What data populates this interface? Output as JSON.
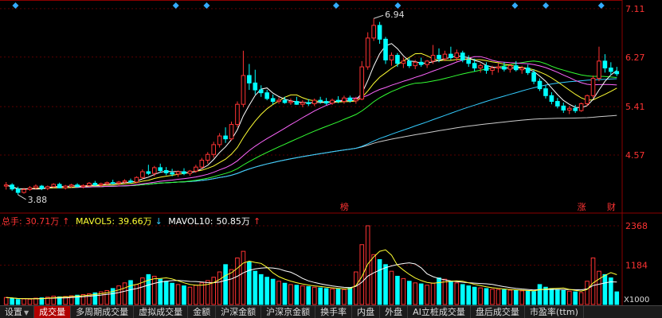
{
  "chart_data": [
    {
      "type": "candlestick",
      "title": "",
      "ylim": [
        3.7,
        7.15
      ],
      "yticks": [
        7.11,
        6.27,
        5.41,
        4.57
      ],
      "annotations": {
        "high_label": "6.94",
        "low_label": "3.88",
        "markers": [
          "榜",
          "涨",
          "财"
        ]
      },
      "colors": {
        "up": "#ff3333",
        "down": "#00ffff",
        "ma5": "#ffffff",
        "ma10": "#ffff33",
        "ma20": "#ff66ff",
        "ma30": "#33ff33",
        "ma60": "#33ccff",
        "ma120": "#cccccc"
      },
      "candles": [
        {
          "o": 4.03,
          "h": 4.1,
          "l": 3.97,
          "c": 4.05
        },
        {
          "o": 4.05,
          "h": 4.08,
          "l": 3.95,
          "c": 3.98
        },
        {
          "o": 3.98,
          "h": 4.02,
          "l": 3.88,
          "c": 3.92
        },
        {
          "o": 3.92,
          "h": 4.0,
          "l": 3.9,
          "c": 3.97
        },
        {
          "o": 3.97,
          "h": 4.03,
          "l": 3.95,
          "c": 4.0
        },
        {
          "o": 4.0,
          "h": 4.06,
          "l": 3.97,
          "c": 4.03
        },
        {
          "o": 4.03,
          "h": 4.05,
          "l": 3.96,
          "c": 3.99
        },
        {
          "o": 3.99,
          "h": 4.04,
          "l": 3.96,
          "c": 4.02
        },
        {
          "o": 4.02,
          "h": 4.08,
          "l": 4.0,
          "c": 4.06
        },
        {
          "o": 4.06,
          "h": 4.09,
          "l": 3.99,
          "c": 4.0
        },
        {
          "o": 4.0,
          "h": 4.05,
          "l": 3.97,
          "c": 4.03
        },
        {
          "o": 4.03,
          "h": 4.07,
          "l": 4.0,
          "c": 4.05
        },
        {
          "o": 4.05,
          "h": 4.08,
          "l": 4.01,
          "c": 4.02
        },
        {
          "o": 4.02,
          "h": 4.06,
          "l": 3.99,
          "c": 4.04
        },
        {
          "o": 4.04,
          "h": 4.1,
          "l": 4.02,
          "c": 4.08
        },
        {
          "o": 4.08,
          "h": 4.12,
          "l": 4.03,
          "c": 4.05
        },
        {
          "o": 4.05,
          "h": 4.09,
          "l": 4.01,
          "c": 4.07
        },
        {
          "o": 4.07,
          "h": 4.11,
          "l": 4.04,
          "c": 4.09
        },
        {
          "o": 4.09,
          "h": 4.14,
          "l": 4.06,
          "c": 4.08
        },
        {
          "o": 4.08,
          "h": 4.12,
          "l": 4.04,
          "c": 4.1
        },
        {
          "o": 4.1,
          "h": 4.15,
          "l": 4.07,
          "c": 4.12
        },
        {
          "o": 4.12,
          "h": 4.16,
          "l": 4.08,
          "c": 4.1
        },
        {
          "o": 4.1,
          "h": 4.2,
          "l": 4.08,
          "c": 4.18
        },
        {
          "o": 4.18,
          "h": 4.32,
          "l": 4.15,
          "c": 4.28
        },
        {
          "o": 4.28,
          "h": 4.4,
          "l": 4.22,
          "c": 4.25
        },
        {
          "o": 4.25,
          "h": 4.38,
          "l": 4.2,
          "c": 4.35
        },
        {
          "o": 4.35,
          "h": 4.42,
          "l": 4.26,
          "c": 4.3
        },
        {
          "o": 4.3,
          "h": 4.36,
          "l": 4.22,
          "c": 4.26
        },
        {
          "o": 4.26,
          "h": 4.33,
          "l": 4.2,
          "c": 4.24
        },
        {
          "o": 4.24,
          "h": 4.3,
          "l": 4.19,
          "c": 4.28
        },
        {
          "o": 4.28,
          "h": 4.34,
          "l": 4.22,
          "c": 4.25
        },
        {
          "o": 4.25,
          "h": 4.31,
          "l": 4.21,
          "c": 4.29
        },
        {
          "o": 4.29,
          "h": 4.4,
          "l": 4.26,
          "c": 4.36
        },
        {
          "o": 4.36,
          "h": 4.52,
          "l": 4.33,
          "c": 4.48
        },
        {
          "o": 4.48,
          "h": 4.62,
          "l": 4.42,
          "c": 4.58
        },
        {
          "o": 4.58,
          "h": 4.8,
          "l": 4.52,
          "c": 4.75
        },
        {
          "o": 4.75,
          "h": 4.95,
          "l": 4.7,
          "c": 4.9
        },
        {
          "o": 4.9,
          "h": 5.05,
          "l": 4.78,
          "c": 4.85
        },
        {
          "o": 4.85,
          "h": 5.15,
          "l": 4.82,
          "c": 5.1
        },
        {
          "o": 5.1,
          "h": 5.5,
          "l": 5.05,
          "c": 5.45
        },
        {
          "o": 5.45,
          "h": 6.38,
          "l": 5.4,
          "c": 5.95
        },
        {
          "o": 5.95,
          "h": 6.15,
          "l": 5.7,
          "c": 5.82
        },
        {
          "o": 5.82,
          "h": 6.05,
          "l": 5.62,
          "c": 5.7
        },
        {
          "o": 5.7,
          "h": 5.78,
          "l": 5.58,
          "c": 5.65
        },
        {
          "o": 5.65,
          "h": 5.7,
          "l": 5.52,
          "c": 5.55
        },
        {
          "o": 5.55,
          "h": 5.62,
          "l": 5.45,
          "c": 5.5
        },
        {
          "o": 5.5,
          "h": 5.57,
          "l": 5.46,
          "c": 5.52
        },
        {
          "o": 5.52,
          "h": 5.58,
          "l": 5.46,
          "c": 5.48
        },
        {
          "o": 5.48,
          "h": 5.55,
          "l": 5.44,
          "c": 5.5
        },
        {
          "o": 5.5,
          "h": 5.58,
          "l": 5.44,
          "c": 5.45
        },
        {
          "o": 5.45,
          "h": 5.52,
          "l": 5.4,
          "c": 5.48
        },
        {
          "o": 5.48,
          "h": 5.54,
          "l": 5.42,
          "c": 5.46
        },
        {
          "o": 5.46,
          "h": 5.55,
          "l": 5.42,
          "c": 5.52
        },
        {
          "o": 5.52,
          "h": 5.58,
          "l": 5.46,
          "c": 5.5
        },
        {
          "o": 5.5,
          "h": 5.56,
          "l": 5.44,
          "c": 5.47
        },
        {
          "o": 5.47,
          "h": 5.55,
          "l": 5.44,
          "c": 5.52
        },
        {
          "o": 5.52,
          "h": 5.59,
          "l": 5.47,
          "c": 5.5
        },
        {
          "o": 5.5,
          "h": 5.6,
          "l": 5.46,
          "c": 5.56
        },
        {
          "o": 5.56,
          "h": 5.6,
          "l": 5.48,
          "c": 5.51
        },
        {
          "o": 5.51,
          "h": 5.58,
          "l": 5.46,
          "c": 5.54
        },
        {
          "o": 5.54,
          "h": 6.2,
          "l": 5.52,
          "c": 6.1
        },
        {
          "o": 6.1,
          "h": 6.7,
          "l": 6.05,
          "c": 6.6
        },
        {
          "o": 6.6,
          "h": 6.94,
          "l": 6.55,
          "c": 6.82
        },
        {
          "o": 6.82,
          "h": 6.88,
          "l": 6.5,
          "c": 6.58
        },
        {
          "o": 6.58,
          "h": 6.62,
          "l": 6.15,
          "c": 6.22
        },
        {
          "o": 6.22,
          "h": 6.35,
          "l": 6.12,
          "c": 6.3
        },
        {
          "o": 6.3,
          "h": 6.34,
          "l": 6.1,
          "c": 6.16
        },
        {
          "o": 6.16,
          "h": 6.26,
          "l": 6.08,
          "c": 6.2
        },
        {
          "o": 6.2,
          "h": 6.25,
          "l": 6.08,
          "c": 6.12
        },
        {
          "o": 6.12,
          "h": 6.22,
          "l": 6.06,
          "c": 6.18
        },
        {
          "o": 6.18,
          "h": 6.26,
          "l": 6.1,
          "c": 6.14
        },
        {
          "o": 6.14,
          "h": 6.22,
          "l": 6.08,
          "c": 6.2
        },
        {
          "o": 6.2,
          "h": 6.48,
          "l": 6.15,
          "c": 6.3
        },
        {
          "o": 6.3,
          "h": 6.42,
          "l": 6.18,
          "c": 6.24
        },
        {
          "o": 6.24,
          "h": 6.38,
          "l": 6.2,
          "c": 6.32
        },
        {
          "o": 6.32,
          "h": 6.45,
          "l": 6.22,
          "c": 6.26
        },
        {
          "o": 6.26,
          "h": 6.4,
          "l": 6.2,
          "c": 6.34
        },
        {
          "o": 6.34,
          "h": 6.38,
          "l": 6.18,
          "c": 6.22
        },
        {
          "o": 6.22,
          "h": 6.3,
          "l": 6.1,
          "c": 6.16
        },
        {
          "o": 6.16,
          "h": 6.24,
          "l": 6.02,
          "c": 6.08
        },
        {
          "o": 6.08,
          "h": 6.16,
          "l": 6.0,
          "c": 6.12
        },
        {
          "o": 6.12,
          "h": 6.18,
          "l": 5.98,
          "c": 6.04
        },
        {
          "o": 6.04,
          "h": 6.12,
          "l": 5.96,
          "c": 6.08
        },
        {
          "o": 6.08,
          "h": 6.16,
          "l": 6.0,
          "c": 6.1
        },
        {
          "o": 6.1,
          "h": 6.18,
          "l": 6.02,
          "c": 6.06
        },
        {
          "o": 6.06,
          "h": 6.15,
          "l": 6.0,
          "c": 6.12
        },
        {
          "o": 6.12,
          "h": 6.2,
          "l": 6.02,
          "c": 6.05
        },
        {
          "o": 6.05,
          "h": 6.12,
          "l": 5.98,
          "c": 6.08
        },
        {
          "o": 6.08,
          "h": 6.14,
          "l": 5.96,
          "c": 6.0
        },
        {
          "o": 6.0,
          "h": 6.06,
          "l": 5.8,
          "c": 5.85
        },
        {
          "o": 5.85,
          "h": 5.9,
          "l": 5.68,
          "c": 5.72
        },
        {
          "o": 5.72,
          "h": 5.78,
          "l": 5.55,
          "c": 5.6
        },
        {
          "o": 5.6,
          "h": 5.66,
          "l": 5.45,
          "c": 5.5
        },
        {
          "o": 5.5,
          "h": 5.56,
          "l": 5.38,
          "c": 5.42
        },
        {
          "o": 5.42,
          "h": 5.48,
          "l": 5.3,
          "c": 5.35
        },
        {
          "o": 5.35,
          "h": 5.42,
          "l": 5.28,
          "c": 5.38
        },
        {
          "o": 5.38,
          "h": 5.44,
          "l": 5.3,
          "c": 5.34
        },
        {
          "o": 5.34,
          "h": 5.48,
          "l": 5.32,
          "c": 5.46
        },
        {
          "o": 5.46,
          "h": 5.62,
          "l": 5.42,
          "c": 5.6
        },
        {
          "o": 5.6,
          "h": 5.95,
          "l": 5.56,
          "c": 5.9
        },
        {
          "o": 5.9,
          "h": 6.45,
          "l": 5.85,
          "c": 6.2
        },
        {
          "o": 6.2,
          "h": 6.32,
          "l": 6.0,
          "c": 6.08
        },
        {
          "o": 6.08,
          "h": 6.18,
          "l": 5.96,
          "c": 6.02
        },
        {
          "o": 6.02,
          "h": 6.1,
          "l": 5.94,
          "c": 5.98
        }
      ],
      "volume": {
        "label": "总手",
        "values": [
          210,
          180,
          150,
          170,
          160,
          190,
          200,
          220,
          250,
          230,
          240,
          260,
          280,
          300,
          320,
          350,
          380,
          420,
          480,
          560,
          650,
          720,
          600,
          800,
          900,
          850,
          760,
          700,
          640,
          600,
          560,
          520,
          580,
          650,
          720,
          820,
          980,
          1200,
          1050,
          1400,
          1600,
          1280,
          1000,
          900,
          820,
          760,
          700,
          640,
          600,
          580,
          560,
          540,
          520,
          500,
          480,
          470,
          460,
          450,
          500,
          980,
          1800,
          2368,
          1500,
          1350,
          1200,
          1000,
          850,
          780,
          700,
          650,
          620,
          580,
          640,
          800,
          760,
          700,
          650,
          600,
          560,
          520,
          500,
          480,
          460,
          450,
          440,
          430,
          420,
          410,
          400,
          390,
          600,
          520,
          480,
          450,
          420,
          400,
          380,
          360,
          700,
          1400,
          1000,
          900,
          800,
          380
        ],
        "legend": {
          "total_label": "总手:",
          "total": "30.71万",
          "mavol5_label": "MAVOL5:",
          "mavol5": "39.66万",
          "mavol10_label": "MAVOL10:",
          "mavol10": "50.85万"
        },
        "yticks": [
          2368,
          1184
        ],
        "unit_label": "X1000"
      }
    }
  ],
  "tabs": [
    {
      "label": "设置",
      "has_arrow": true
    },
    {
      "label": "成交量",
      "active": true
    },
    {
      "label": "多周期成交量"
    },
    {
      "label": "虚拟成交量"
    },
    {
      "label": "金额"
    },
    {
      "label": "沪深金额"
    },
    {
      "label": "沪深京金额"
    },
    {
      "label": "换手率"
    },
    {
      "label": "内盘"
    },
    {
      "label": "外盘"
    },
    {
      "label": "AI立桩成交量"
    },
    {
      "label": "盘后成交量"
    },
    {
      "label": "市盈率(ttm)"
    }
  ]
}
